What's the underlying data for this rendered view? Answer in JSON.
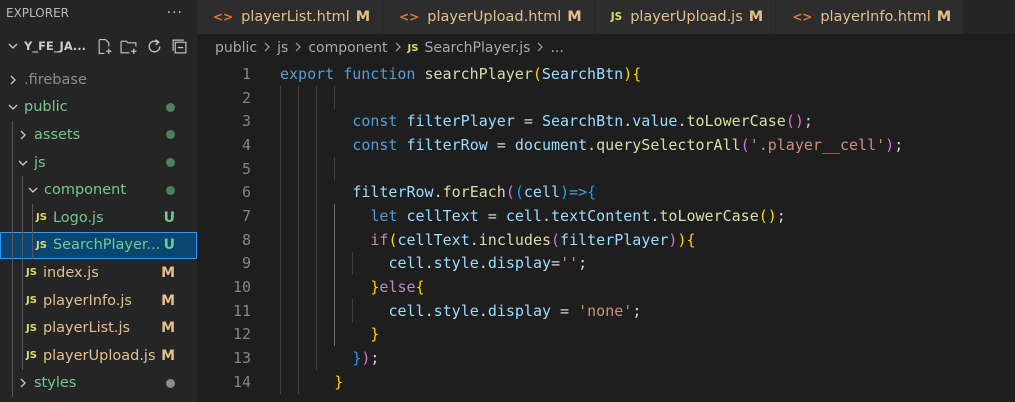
{
  "sidebar": {
    "title": "EXPLORER",
    "more": "···",
    "project": "Y_FE_JA...",
    "tree": [
      {
        "label": ".firebase",
        "type": "folder",
        "open": false,
        "depth": 0,
        "color": "grey",
        "mark": "",
        "dot": ""
      },
      {
        "label": "public",
        "type": "folder",
        "open": true,
        "depth": 0,
        "color": "green",
        "mark": "",
        "dot": "green"
      },
      {
        "label": "assets",
        "type": "folder",
        "open": false,
        "depth": 1,
        "color": "green",
        "mark": "",
        "dot": "green"
      },
      {
        "label": "js",
        "type": "folder",
        "open": true,
        "depth": 1,
        "color": "green",
        "mark": "",
        "dot": "green"
      },
      {
        "label": "component",
        "type": "folder",
        "open": true,
        "depth": 2,
        "color": "green",
        "mark": "",
        "dot": "green"
      },
      {
        "label": "Logo.js",
        "type": "js",
        "depth": 3,
        "color": "untracked",
        "mark": "U",
        "dot": ""
      },
      {
        "label": "SearchPlayer...",
        "type": "js",
        "depth": 3,
        "color": "untracked",
        "mark": "U",
        "dot": "",
        "selected": true
      },
      {
        "label": "index.js",
        "type": "js",
        "depth": 2,
        "color": "mod",
        "mark": "M",
        "dot": ""
      },
      {
        "label": "playerInfo.js",
        "type": "js",
        "depth": 2,
        "color": "mod",
        "mark": "M",
        "dot": ""
      },
      {
        "label": "playerList.js",
        "type": "js",
        "depth": 2,
        "color": "mod",
        "mark": "M",
        "dot": ""
      },
      {
        "label": "playerUpload.js",
        "type": "js",
        "depth": 2,
        "color": "mod",
        "mark": "M",
        "dot": ""
      },
      {
        "label": "styles",
        "type": "folder",
        "open": false,
        "depth": 1,
        "color": "green",
        "mark": "",
        "dot": "grey"
      }
    ]
  },
  "tabs": [
    {
      "label": "playerList.html",
      "kind": "html",
      "status": "M"
    },
    {
      "label": "playerUpload.html",
      "kind": "html",
      "status": "M"
    },
    {
      "label": "playerUpload.js",
      "kind": "js",
      "status": "M"
    },
    {
      "label": "playerInfo.html",
      "kind": "html",
      "status": "M"
    }
  ],
  "icons": {
    "html": "<>",
    "js": "JS"
  },
  "breadcrumb": {
    "parts": [
      "public",
      "js",
      "component"
    ],
    "file": "SearchPlayer.js",
    "tail": "..."
  },
  "editor": {
    "lines": [
      {
        "n": "1",
        "indent": 0,
        "tokens": [
          [
            "kw",
            "export"
          ],
          [
            "op",
            " "
          ],
          [
            "kw",
            "function"
          ],
          [
            "op",
            " "
          ],
          [
            "fn",
            "searchPlayer"
          ],
          [
            "br1",
            "("
          ],
          [
            "var",
            "SearchBtn"
          ],
          [
            "br1",
            ")"
          ],
          [
            "br1",
            "{"
          ]
        ]
      },
      {
        "n": "2",
        "indent": 0,
        "tokens": []
      },
      {
        "n": "3",
        "indent": 8,
        "tokens": [
          [
            "kw",
            "const"
          ],
          [
            "op",
            " "
          ],
          [
            "var",
            "filterPlayer"
          ],
          [
            "op",
            " = "
          ],
          [
            "var",
            "SearchBtn"
          ],
          [
            "op",
            "."
          ],
          [
            "var",
            "value"
          ],
          [
            "op",
            "."
          ],
          [
            "fn",
            "toLowerCase"
          ],
          [
            "br2",
            "()"
          ],
          [
            "op",
            ";"
          ]
        ]
      },
      {
        "n": "4",
        "indent": 8,
        "tokens": [
          [
            "kw",
            "const"
          ],
          [
            "op",
            " "
          ],
          [
            "var",
            "filterRow"
          ],
          [
            "op",
            " = "
          ],
          [
            "var",
            "document"
          ],
          [
            "op",
            "."
          ],
          [
            "fn",
            "querySelectorAll"
          ],
          [
            "br2",
            "("
          ],
          [
            "str",
            "'.player__cell'"
          ],
          [
            "br2",
            ")"
          ],
          [
            "op",
            ";"
          ]
        ]
      },
      {
        "n": "5",
        "indent": 0,
        "tokens": []
      },
      {
        "n": "6",
        "indent": 8,
        "tokens": [
          [
            "var",
            "filterRow"
          ],
          [
            "op",
            "."
          ],
          [
            "fn",
            "forEach"
          ],
          [
            "br2",
            "("
          ],
          [
            "br3",
            "("
          ],
          [
            "var",
            "cell"
          ],
          [
            "br3",
            ")"
          ],
          [
            "kw",
            "=>"
          ],
          [
            "br3",
            "{"
          ]
        ]
      },
      {
        "n": "7",
        "indent": 10,
        "tokens": [
          [
            "kw",
            "let"
          ],
          [
            "op",
            " "
          ],
          [
            "var",
            "cellText"
          ],
          [
            "op",
            " = "
          ],
          [
            "var",
            "cell"
          ],
          [
            "op",
            "."
          ],
          [
            "var",
            "textContent"
          ],
          [
            "op",
            "."
          ],
          [
            "fn",
            "toLowerCase"
          ],
          [
            "br1",
            "()"
          ],
          [
            "op",
            ";"
          ]
        ]
      },
      {
        "n": "8",
        "indent": 10,
        "tokens": [
          [
            "kw2",
            "if"
          ],
          [
            "br1",
            "("
          ],
          [
            "var",
            "cellText"
          ],
          [
            "op",
            "."
          ],
          [
            "fn",
            "includes"
          ],
          [
            "br2",
            "("
          ],
          [
            "var",
            "filterPlayer"
          ],
          [
            "br2",
            ")"
          ],
          [
            "br1",
            ")"
          ],
          [
            "br1",
            "{"
          ]
        ]
      },
      {
        "n": "9",
        "indent": 12,
        "tokens": [
          [
            "var",
            "cell"
          ],
          [
            "op",
            "."
          ],
          [
            "var",
            "style"
          ],
          [
            "op",
            "."
          ],
          [
            "var",
            "display"
          ],
          [
            "op",
            "="
          ],
          [
            "str",
            "''"
          ],
          [
            "op",
            ";"
          ]
        ]
      },
      {
        "n": "10",
        "indent": 10,
        "tokens": [
          [
            "br1",
            "}"
          ],
          [
            "kw2",
            "else"
          ],
          [
            "br1",
            "{"
          ]
        ]
      },
      {
        "n": "11",
        "indent": 12,
        "tokens": [
          [
            "var",
            "cell"
          ],
          [
            "op",
            "."
          ],
          [
            "var",
            "style"
          ],
          [
            "op",
            "."
          ],
          [
            "var",
            "display"
          ],
          [
            "op",
            " = "
          ],
          [
            "str",
            "'none'"
          ],
          [
            "op",
            ";"
          ]
        ]
      },
      {
        "n": "12",
        "indent": 10,
        "tokens": [
          [
            "br1",
            "}"
          ]
        ]
      },
      {
        "n": "13",
        "indent": 8,
        "tokens": [
          [
            "br3",
            "}"
          ],
          [
            "br2",
            ")"
          ],
          [
            "op",
            ";"
          ]
        ]
      },
      {
        "n": "14",
        "indent": 6,
        "tokens": [
          [
            "br1",
            "}"
          ]
        ]
      }
    ]
  }
}
